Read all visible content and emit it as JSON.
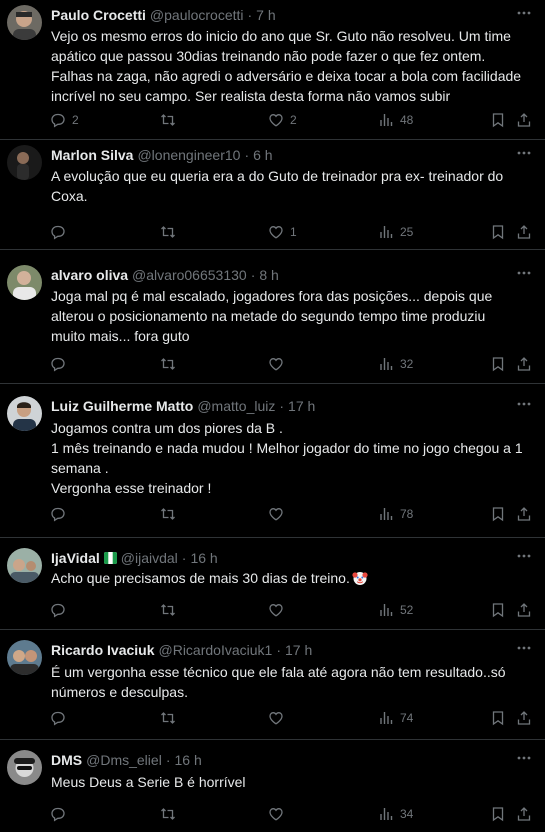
{
  "colors": {
    "background": "#000000",
    "text": "#e7e9ea",
    "muted": "#71767b",
    "divider": "#2f3336"
  },
  "icons": {
    "more": "more-horizontal-icon",
    "reply": "reply-bubble-icon",
    "retweet": "retweet-icon",
    "like": "heart-icon",
    "views": "views-bar-chart-icon",
    "bookmark": "bookmark-icon",
    "share": "share-upload-icon"
  },
  "tweets": [
    {
      "name": "Paulo Crocetti",
      "handle": "@paulocrocetti",
      "time": "7 h",
      "text": "Vejo os mesmo erros do inicio do ano que Sr. Guto não resolveu. Um time\napático que passou 30dias treinando não pode fazer o que fez ontem.\nFalhas na zaga, não agredi o adversário e deixa tocar a bola com facilidade\nincrível no seu campo. Ser realista desta forma não vamos subir",
      "replies": "2",
      "retweets": "",
      "likes": "2",
      "views": "48"
    },
    {
      "name": "Marlon Silva",
      "handle": "@lonengineer10",
      "time": "6 h",
      "text": "A evolução que eu queria era a do Guto de treinador pra ex- treinador do\nCoxa.",
      "replies": "",
      "retweets": "",
      "likes": "1",
      "views": "25"
    },
    {
      "name": "alvaro oliva",
      "handle": "@alvaro06653130",
      "time": "8 h",
      "text": "Joga mal pq é mal escalado, jogadores fora das posições... depois que\nalterou o posicionamento na metade do segundo tempo time produziu\nmuito mais... fora guto",
      "replies": "",
      "retweets": "",
      "likes": "",
      "views": "32"
    },
    {
      "name": "Luiz Guilherme Matto",
      "handle": "@matto_luiz",
      "time": "17 h",
      "text": "Jogamos contra um dos piores da B .\n1 mês treinando e nada mudou ! Melhor jogador do time no jogo chegou a 1\nsemana .\nVergonha esse treinador !",
      "replies": "",
      "retweets": "",
      "likes": "",
      "views": "78"
    },
    {
      "name": "IjaVidal",
      "handle": "@ijaivdal",
      "time": "16 h",
      "text": "Acho que precisamos de mais 30 dias de treino.",
      "replies": "",
      "retweets": "",
      "likes": "",
      "views": "52"
    },
    {
      "name": "Ricardo Ivaciuk",
      "handle": "@RicardoIvaciuk1",
      "time": "17 h",
      "text": "É um vergonha esse técnico  que ele fala até agora não tem resultado..só\nnúmeros e desculpas.",
      "replies": "",
      "retweets": "",
      "likes": "",
      "views": "74"
    },
    {
      "name": "DMS",
      "handle": "@Dms_eliel",
      "time": "16 h",
      "text": "Meus Deus a Serie B é horrível",
      "replies": "",
      "retweets": "",
      "likes": "",
      "views": "34"
    }
  ]
}
